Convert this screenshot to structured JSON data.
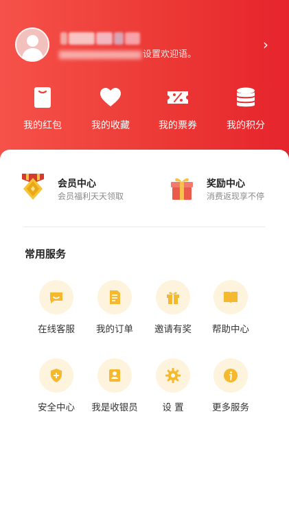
{
  "header": {
    "greeting_suffix": "设置欢迎语。",
    "chevron": "›"
  },
  "quick_links": [
    {
      "label": "我的红包",
      "icon": "red-envelope-icon"
    },
    {
      "label": "我的收藏",
      "icon": "heart-icon"
    },
    {
      "label": "我的票券",
      "icon": "coupon-icon"
    },
    {
      "label": "我的积分",
      "icon": "coins-stack-icon"
    }
  ],
  "features": [
    {
      "title": "会员中心",
      "subtitle": "会员福利天天领取",
      "icon": "medal-icon"
    },
    {
      "title": "奖励中心",
      "subtitle": "消费返现享不停",
      "icon": "gift-box-icon"
    }
  ],
  "services": {
    "title": "常用服务",
    "items": [
      {
        "label": "在线客服",
        "icon": "chat-smile-icon"
      },
      {
        "label": "我的订单",
        "icon": "order-document-icon"
      },
      {
        "label": "邀请有奖",
        "icon": "gift-icon"
      },
      {
        "label": "帮助中心",
        "icon": "book-icon"
      },
      {
        "label": "安全中心",
        "icon": "shield-plus-icon"
      },
      {
        "label": "我是收银员",
        "icon": "cashier-icon"
      },
      {
        "label": "设 置",
        "icon": "gear-icon"
      },
      {
        "label": "更多服务",
        "icon": "info-icon"
      }
    ]
  },
  "colors": {
    "header_red": "#ec3a36",
    "service_icon": "#f5b82e",
    "service_bg": "#fef4dd"
  }
}
